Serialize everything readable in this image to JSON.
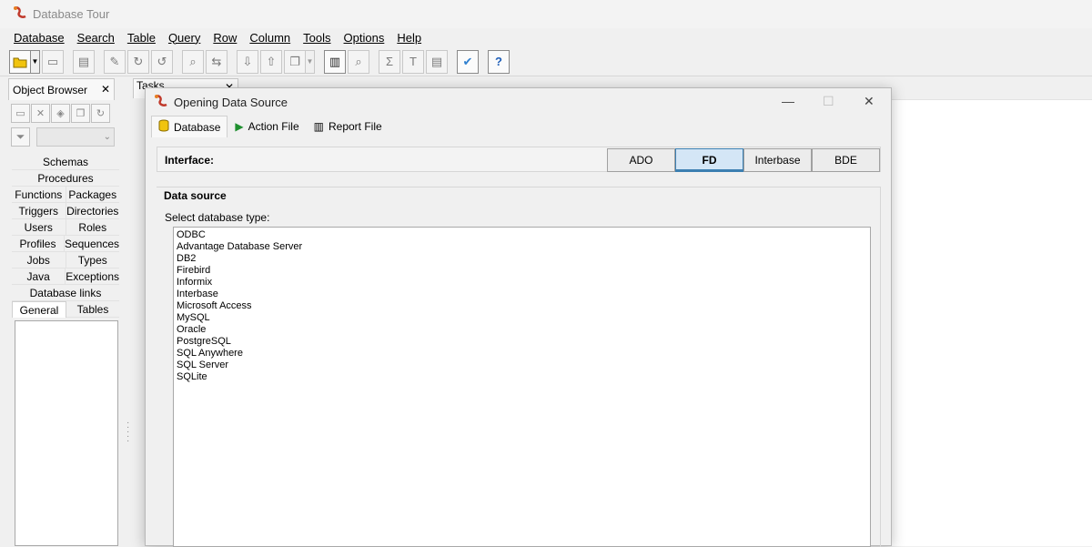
{
  "app": {
    "title": "Database Tour",
    "menu": [
      "Database",
      "Search",
      "Table",
      "Query",
      "Row",
      "Column",
      "Tools",
      "Options",
      "Help"
    ]
  },
  "toolbar": {
    "icons": [
      "open-database-icon",
      "dropdown-icon",
      "open-folder-icon",
      "edit-doc-icon",
      "edit-icon",
      "redo-icon",
      "undo-icon",
      "binoculars-icon",
      "find-replace-icon",
      "import-icon",
      "export-icon",
      "copy-icon",
      "report-icon",
      "preview-icon",
      "sum-icon",
      "text-icon",
      "notes-icon",
      "checklist-icon",
      "help-icon"
    ]
  },
  "object_browser": {
    "tab_label": "Object Browser",
    "categories": [
      [
        "Schemas"
      ],
      [
        "Procedures"
      ],
      [
        "Functions",
        "Packages"
      ],
      [
        "Triggers",
        "Directories"
      ],
      [
        "Users",
        "Roles"
      ],
      [
        "Profiles",
        "Sequences"
      ],
      [
        "Jobs",
        "Types"
      ],
      [
        "Java",
        "Exceptions"
      ],
      [
        "Database links"
      ]
    ],
    "tabs": [
      "General",
      "Tables"
    ]
  },
  "tasks": {
    "tab_label": "Tasks"
  },
  "dialog": {
    "title": "Opening Data Source",
    "tabs": [
      "Database",
      "Action File",
      "Report File"
    ],
    "interface_label": "Interface:",
    "interfaces": [
      "ADO",
      "FD",
      "Interbase",
      "BDE"
    ],
    "selected_interface": "FD",
    "data_source_title": "Data source",
    "select_type_label": "Select database type:",
    "database_types": [
      "ODBC",
      "Advantage Database Server",
      "DB2",
      "Firebird",
      "Informix",
      "Interbase",
      "Microsoft Access",
      "MySQL",
      "Oracle",
      "PostgreSQL",
      "SQL Anywhere",
      "SQL Server",
      "SQLite"
    ]
  },
  "colors": {
    "accent": "#3c7fb1",
    "selected_bg": "#d4e6f6"
  }
}
